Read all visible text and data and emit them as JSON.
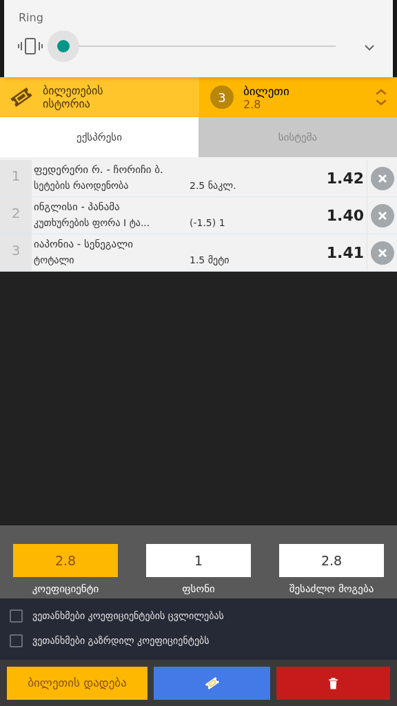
{
  "volume_panel": {
    "title": "Ring"
  },
  "header": {
    "history_label": "ბილეთების ისტორია",
    "ticket_count": "3",
    "ticket_label": "ბილეთი",
    "ticket_odds": "2.8"
  },
  "tabs": [
    {
      "label": "ექსპრესი",
      "selected": true
    },
    {
      "label": "სისტემა",
      "selected": false
    }
  ],
  "bets": [
    {
      "index": "1",
      "match": "ფედერერი რ. - ჩორიჩი ბ.",
      "market": "სეტების რაოდენობა",
      "pick": "2.5 ნაკლ.",
      "odds": "1.42"
    },
    {
      "index": "2",
      "match": "ინგლისი - პანამა",
      "market": "კუთხურების ფორა I ტა...",
      "pick": "(-1.5) 1",
      "odds": "1.40"
    },
    {
      "index": "3",
      "match": "იაპონია - სენეგალი",
      "market": "ტოტალი",
      "pick": "1.5 მეტი",
      "odds": "1.41"
    }
  ],
  "stake_fields": [
    {
      "kind": "highlight",
      "value": "2.8",
      "label": "კოეფიციენტი"
    },
    {
      "kind": "plain",
      "value": "1",
      "label": "ფსონი"
    },
    {
      "kind": "plain",
      "value": "2.8",
      "label": "შესაძლო მოგება"
    }
  ],
  "agreements": [
    {
      "label": "ვეთანხმები კოეფიციენტების ცვლილებას",
      "checked": false
    },
    {
      "label": "ვეთანხმები გაზრდილ კოეფიციენტებს",
      "checked": false
    }
  ],
  "actions": [
    {
      "kind": "place",
      "label": "ბილეთის დადება"
    },
    {
      "kind": "ticket"
    },
    {
      "kind": "delete"
    }
  ]
}
